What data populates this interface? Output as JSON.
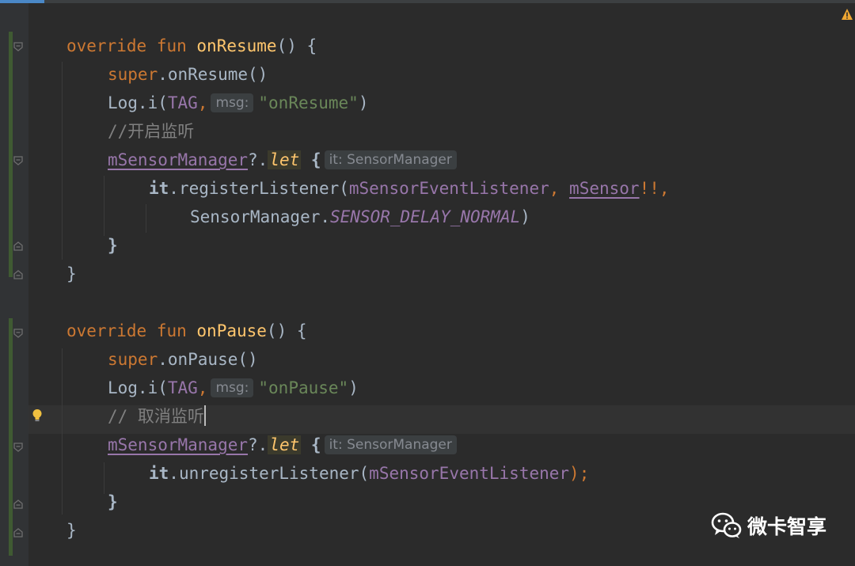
{
  "theme": {
    "background": "#2b2b2b",
    "keyword": "#cc7832",
    "function": "#ffc66d",
    "string": "#6a8759",
    "comment": "#808080",
    "constant": "#9876aa",
    "default_text": "#a9b7c6"
  },
  "code": {
    "resume_override": "override",
    "resume_fun": "fun",
    "resume_name": "onResume",
    "resume_sig_tail": "() {",
    "super_kw_1": "super",
    "super_call_1": ".onResume()",
    "log_prefix_1": "Log.i(",
    "tag_1": "TAG",
    "comma_1": ",",
    "msg_hint_1": "msg:",
    "log_str_1": "\"onResume\"",
    "log_close_1": ")",
    "comment_1": "//开启监听",
    "mgr_prop_1": "mSensorManager",
    "safe_call_1": "?.",
    "let_1": "let",
    "brace_open_1": "{",
    "it_hint_1": "it: SensorManager",
    "it_kw_1": "it",
    "register_call": ".registerListener(",
    "listener_arg_1": "mSensorEventListener",
    "comma_2": ", ",
    "sensor_prop": "mSensor",
    "not_null": "!!,",
    "sensor_manager_cls": "SensorManager.",
    "delay_const": "SENSOR_DELAY_NORMAL",
    "register_close": ")",
    "brace_close_1": "}",
    "fun_close_1": "}",
    "pause_override": "override",
    "pause_fun": "fun",
    "pause_name": "onPause",
    "pause_sig_tail": "() {",
    "super_kw_2": "super",
    "super_call_2": ".onPause()",
    "log_prefix_2": "Log.i(",
    "tag_2": "TAG",
    "comma_3": ",",
    "msg_hint_2": "msg:",
    "log_str_2": "\"onPause\"",
    "log_close_2": ")",
    "comment_2": "// 取消监听",
    "mgr_prop_2": "mSensorManager",
    "safe_call_2": "?.",
    "let_2": "let",
    "brace_open_2": "{",
    "it_hint_2": "it: SensorManager",
    "it_kw_2": "it",
    "unregister_call": ".unregisterListener(",
    "listener_arg_2": "mSensorEventListener",
    "unregister_close": ");",
    "brace_close_2": "}",
    "fun_close_2": "}"
  },
  "watermark": {
    "text": "微卡智享",
    "icon": "wechat-icon"
  },
  "icons": {
    "fold": "fold-marker-icon",
    "bulb": "lightbulb-icon",
    "warning": "warning-icon"
  }
}
